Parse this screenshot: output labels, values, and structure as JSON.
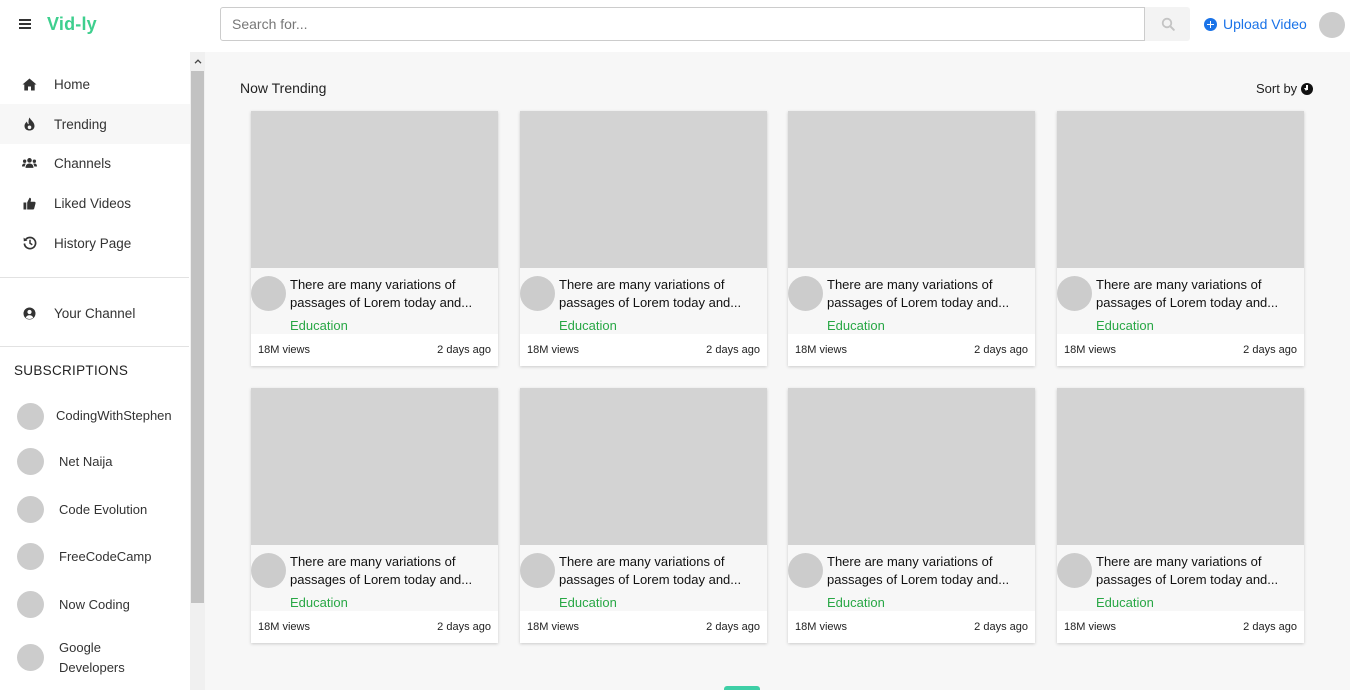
{
  "header": {
    "brand": "Vid-ly",
    "search_placeholder": "Search for...",
    "upload_label": "Upload Video"
  },
  "sidebar": {
    "nav": [
      {
        "label": "Home",
        "icon": "home-icon"
      },
      {
        "label": "Trending",
        "icon": "fire-icon"
      },
      {
        "label": "Channels",
        "icon": "users-icon"
      },
      {
        "label": "Liked Videos",
        "icon": "thumbs-up-icon"
      },
      {
        "label": "History Page",
        "icon": "history-icon"
      }
    ],
    "your_channel": {
      "label": "Your Channel",
      "icon": "user-circle-icon"
    },
    "subscriptions_title": "SUBSCRIPTIONS",
    "subscriptions": [
      "CodingWithStephen",
      "Net Naija",
      "Code Evolution",
      "FreeCodeCamp",
      "Now Coding",
      "Google Developers"
    ]
  },
  "main": {
    "section_title": "Now Trending",
    "sort_label": "Sort by",
    "videos": [
      {
        "title": "There are many variations of passages of Lorem today and...",
        "category": "Education",
        "views": "18M views",
        "time": "2 days ago"
      },
      {
        "title": "There are many variations of passages of Lorem today and...",
        "category": "Education",
        "views": "18M views",
        "time": "2 days ago"
      },
      {
        "title": "There are many variations of passages of Lorem today and...",
        "category": "Education",
        "views": "18M views",
        "time": "2 days ago"
      },
      {
        "title": "There are many variations of passages of Lorem today and...",
        "category": "Education",
        "views": "18M views",
        "time": "2 days ago"
      },
      {
        "title": "There are many variations of passages of Lorem today and...",
        "category": "Education",
        "views": "18M views",
        "time": "2 days ago"
      },
      {
        "title": "There are many variations of passages of Lorem today and...",
        "category": "Education",
        "views": "18M views",
        "time": "2 days ago"
      },
      {
        "title": "There are many variations of passages of Lorem today and...",
        "category": "Education",
        "views": "18M views",
        "time": "2 days ago"
      },
      {
        "title": "There are many variations of passages of Lorem today and...",
        "category": "Education",
        "views": "18M views",
        "time": "2 days ago"
      }
    ]
  },
  "colors": {
    "brand": "#3ecf8e",
    "link": "#1a73e8",
    "category": "#28a745"
  }
}
